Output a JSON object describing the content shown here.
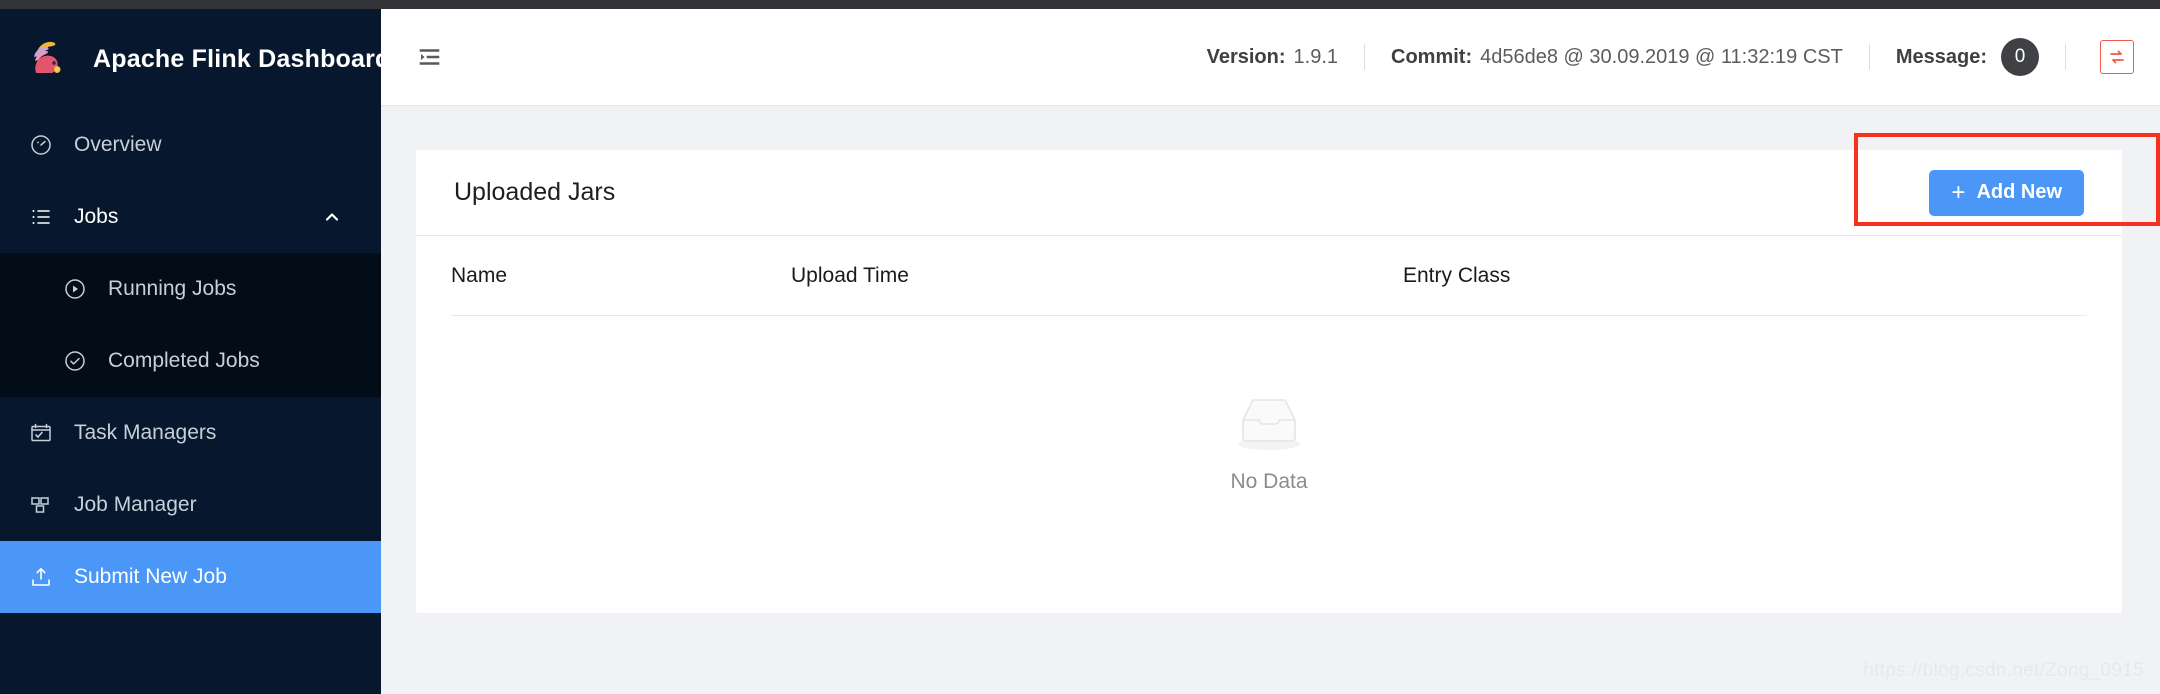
{
  "brand": {
    "title": "Apache Flink Dashboard",
    "logo_icon": "flink-squirrel-logo"
  },
  "sidebar": {
    "items": [
      {
        "label": "Overview",
        "icon": "dashboard-icon",
        "state": "default"
      },
      {
        "label": "Jobs",
        "icon": "list-icon",
        "state": "parent-expanded",
        "chevron": "chevron-up-icon"
      },
      {
        "label": "Running Jobs",
        "icon": "play-circle-icon",
        "state": "sub"
      },
      {
        "label": "Completed Jobs",
        "icon": "check-circle-icon",
        "state": "sub"
      },
      {
        "label": "Task Managers",
        "icon": "task-manager-icon",
        "state": "default"
      },
      {
        "label": "Job Manager",
        "icon": "job-manager-icon",
        "state": "default"
      },
      {
        "label": "Submit New Job",
        "icon": "upload-icon",
        "state": "active"
      }
    ],
    "active_color": "#4a97f7"
  },
  "header": {
    "fold_icon": "menu-fold-icon",
    "version_label": "Version:",
    "version_value": "1.9.1",
    "commit_label": "Commit:",
    "commit_value": "4d56de8 @ 30.09.2019 @ 11:32:19 CST",
    "message_label": "Message:",
    "message_count": "0",
    "refresh_icon": "refresh-toggle-icon",
    "refresh_color": "#f05a4a"
  },
  "main": {
    "card_title": "Uploaded Jars",
    "add_button": {
      "label": "Add New",
      "plus_icon": "plus-icon",
      "color": "#4a97f7"
    },
    "table": {
      "columns": [
        "Name",
        "Upload Time",
        "Entry Class"
      ],
      "rows": [],
      "empty_icon": "empty-box-icon",
      "empty_text": "No Data"
    }
  },
  "annotation": {
    "color": "#f6321f",
    "target": "add-new-button"
  },
  "watermark": "https://blog.csdn.net/Zong_0915"
}
